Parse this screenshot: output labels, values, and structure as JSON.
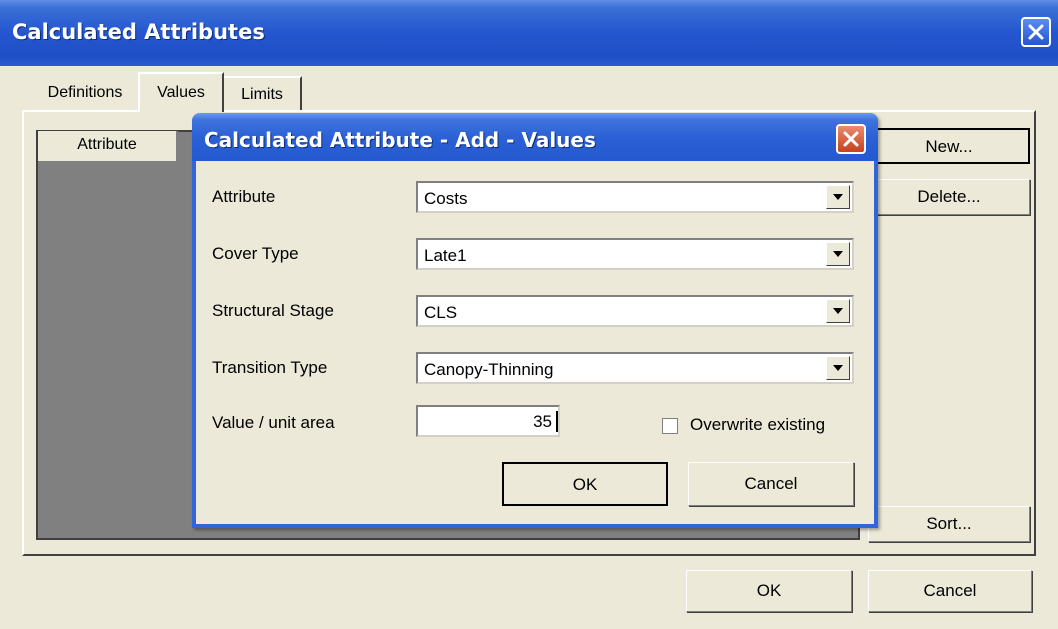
{
  "window": {
    "title": "Calculated Attributes",
    "tabs": [
      {
        "label": "Definitions",
        "selected": false
      },
      {
        "label": "Values",
        "selected": true
      },
      {
        "label": "Limits",
        "selected": false
      }
    ],
    "list": {
      "column_header": "Attribute"
    },
    "buttons": {
      "new": "New...",
      "delete": "Delete...",
      "sort": "Sort...",
      "ok": "OK",
      "cancel": "Cancel"
    }
  },
  "dialog": {
    "title": "Calculated Attribute - Add - Values",
    "fields": {
      "attribute": {
        "label": "Attribute",
        "value": "Costs"
      },
      "cover_type": {
        "label": "Cover Type",
        "value": "Late1"
      },
      "structural_stage": {
        "label": "Structural Stage",
        "value": "CLS"
      },
      "transition_type": {
        "label": "Transition Type",
        "value": "Canopy-Thinning"
      },
      "value_per_unit_area": {
        "label": "Value / unit area",
        "value": "35"
      }
    },
    "overwrite_existing": {
      "label": "Overwrite existing",
      "checked": false
    },
    "buttons": {
      "ok": "OK",
      "cancel": "Cancel"
    }
  },
  "colors": {
    "titlebar": "#2456d0",
    "dialog_bg": "#ece9d8",
    "list_bg": "#808080",
    "close_red": "#c8401e"
  },
  "icons": [
    "close-icon",
    "dropdown-arrow-icon"
  ]
}
